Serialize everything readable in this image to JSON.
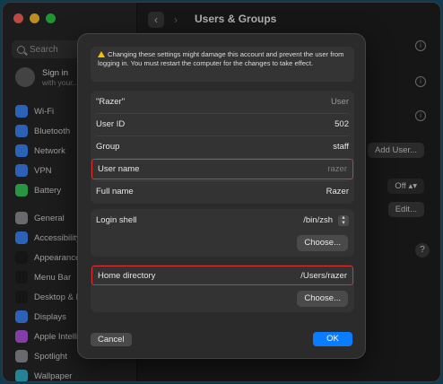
{
  "window": {
    "title": "Users & Groups"
  },
  "sidebar": {
    "search_placeholder": "Search",
    "signin": {
      "title": "Sign in",
      "subtitle": "with your..."
    },
    "items": [
      {
        "label": "Wi-Fi",
        "icon": "wifi-icon",
        "color": "#3b82f6"
      },
      {
        "label": "Bluetooth",
        "icon": "bluetooth-icon",
        "color": "#3b82f6"
      },
      {
        "label": "Network",
        "icon": "globe-icon",
        "color": "#3b82f6"
      },
      {
        "label": "VPN",
        "icon": "vpn-icon",
        "color": "#3b82f6"
      },
      {
        "label": "Battery",
        "icon": "battery-icon",
        "color": "#34c759"
      },
      {
        "label": "General",
        "icon": "gear-icon",
        "color": "#8e8e93"
      },
      {
        "label": "Accessibility",
        "icon": "accessibility-icon",
        "color": "#3b82f6"
      },
      {
        "label": "Appearance",
        "icon": "appearance-icon",
        "color": "#1c1c1e"
      },
      {
        "label": "Menu Bar",
        "icon": "menubar-icon",
        "color": "#1c1c1e"
      },
      {
        "label": "Desktop & D...",
        "icon": "desktop-icon",
        "color": "#1c1c1e"
      },
      {
        "label": "Displays",
        "icon": "display-icon",
        "color": "#3b82f6"
      },
      {
        "label": "Apple Intellig...",
        "icon": "intelligence-icon",
        "color": "#af52de"
      },
      {
        "label": "Spotlight",
        "icon": "spotlight-icon",
        "color": "#8e8e93"
      },
      {
        "label": "Wallpaper",
        "icon": "wallpaper-icon",
        "color": "#30b0c7"
      }
    ]
  },
  "background": {
    "add_user_label": "Add User...",
    "off_label": "Off",
    "edit_label": "Edit...",
    "help_label": "?"
  },
  "dialog": {
    "warning": "Changing these settings might damage this account and prevent the user from logging in. You must restart the computer for the changes to take effect.",
    "rows": {
      "account": {
        "label": "\"Razer\"",
        "value": "User"
      },
      "user_id": {
        "label": "User ID",
        "value": "502"
      },
      "group": {
        "label": "Group",
        "value": "staff"
      },
      "user_name": {
        "label": "User name",
        "value": "razer"
      },
      "full_name": {
        "label": "Full name",
        "value": "Razer"
      },
      "login_shell": {
        "label": "Login shell",
        "value": "/bin/zsh"
      },
      "home_directory": {
        "label": "Home directory",
        "value": "/Users/razer"
      }
    },
    "choose_label": "Choose...",
    "cancel_label": "Cancel",
    "ok_label": "OK"
  }
}
